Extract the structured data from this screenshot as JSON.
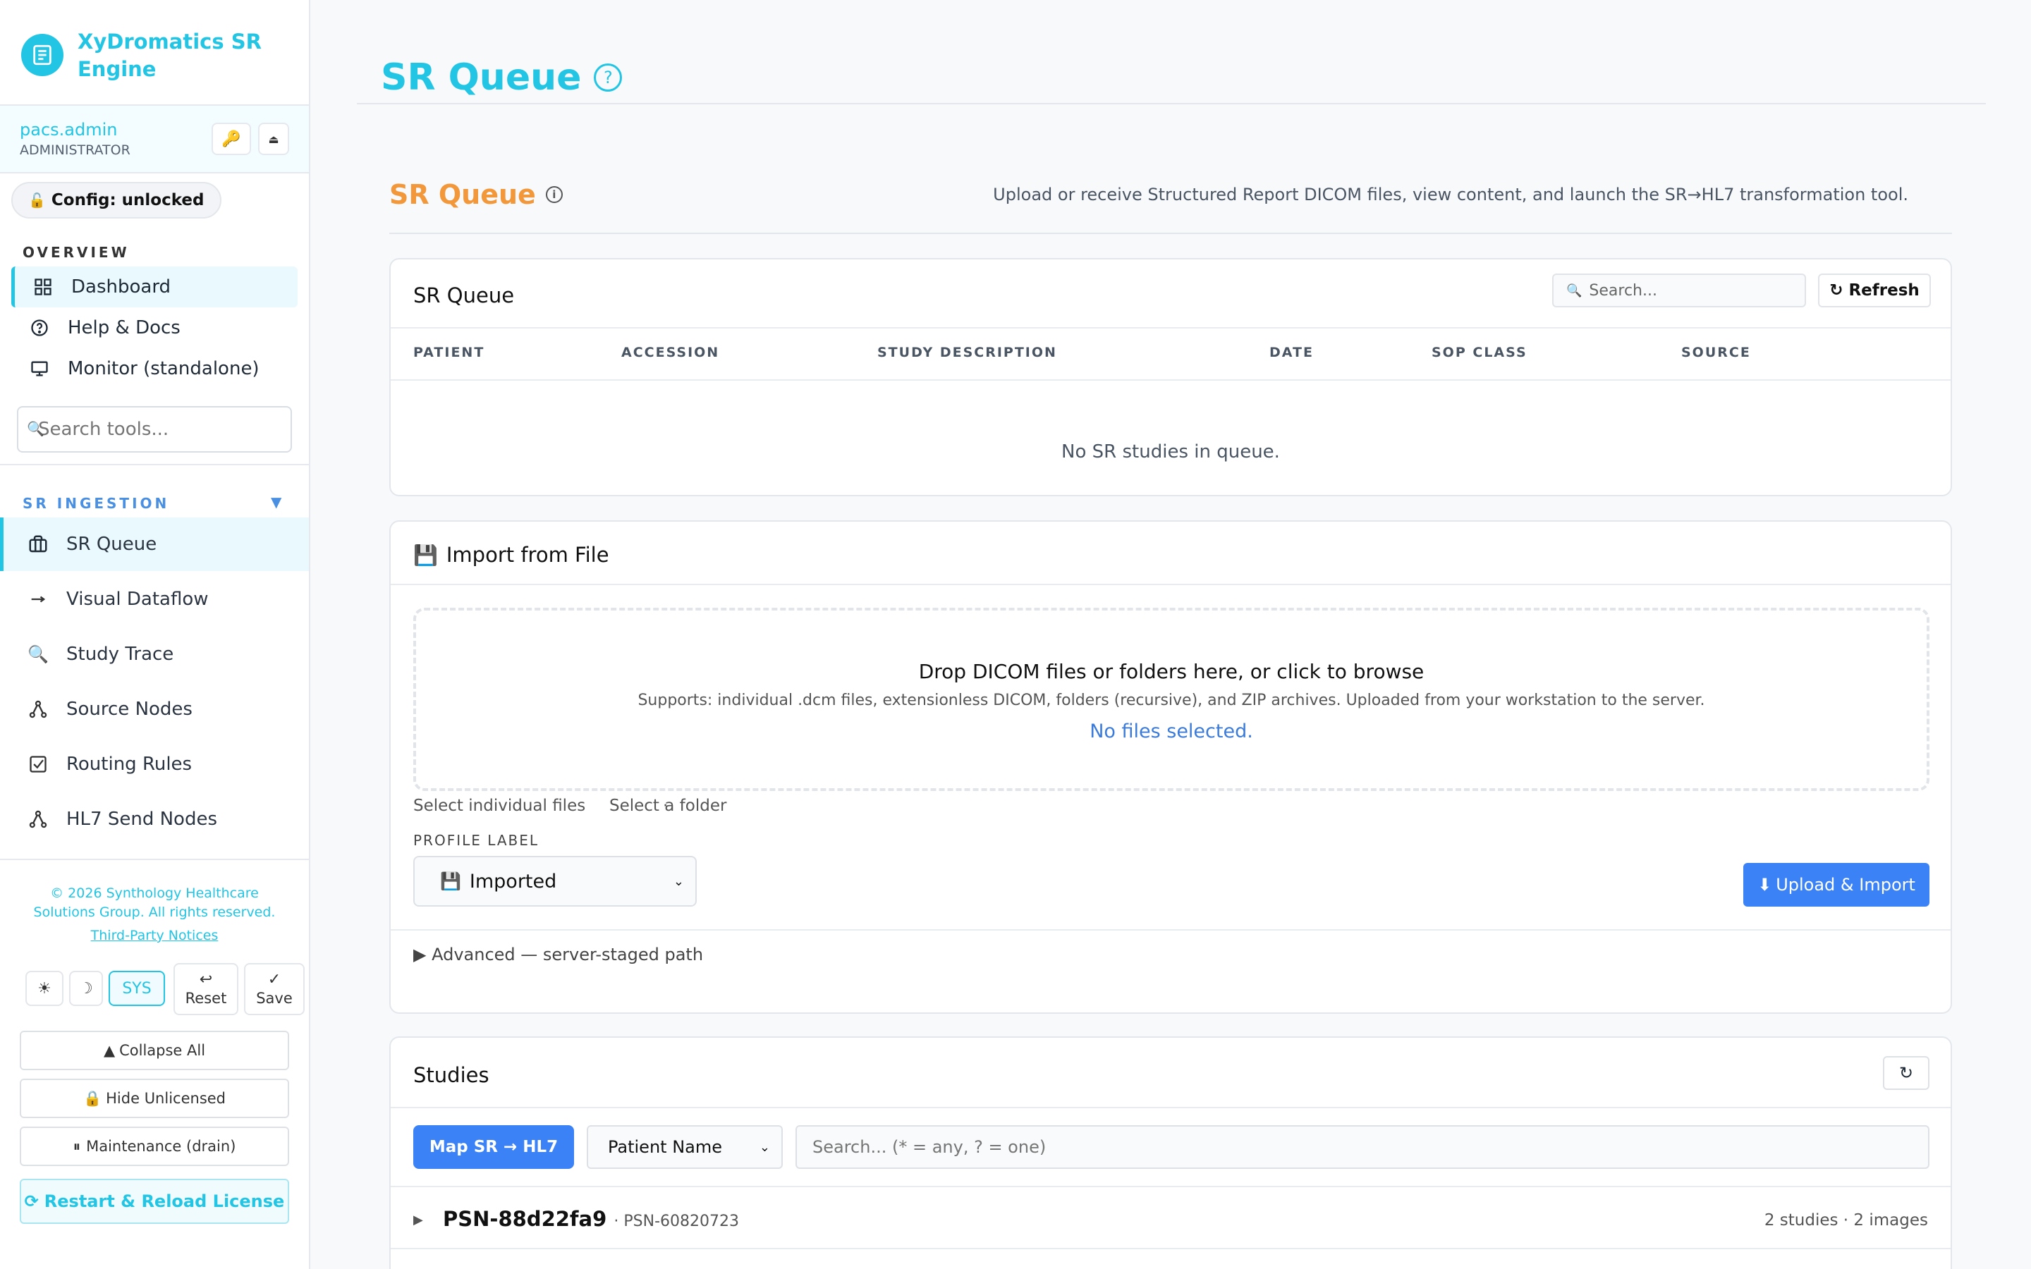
{
  "app": {
    "brand": "XyDromatics SR Engine",
    "user": "pacs.admin",
    "role": "ADMINISTRATOR",
    "config_badge": "Config: unlocked",
    "accent": "#22c5e4",
    "orange": "#f2983a",
    "blue": "#3b82f6"
  },
  "sidebar": {
    "overview_label": "OVERVIEW",
    "overview_items": [
      "Dashboard",
      "Help & Docs",
      "Monitor (standalone)"
    ],
    "search_placeholder": "Search tools...",
    "ingestion_label": "SR INGESTION",
    "ingestion_items": [
      "SR Queue",
      "Visual Dataflow",
      "Study Trace",
      "Source Nodes",
      "Routing Rules",
      "HL7 Send Nodes"
    ],
    "footer_line1": "© 2026 Synthology Healthcare",
    "footer_line2": "Solutions Group. All rights reserved.",
    "footer_link": "Third-Party Notices",
    "theme_sys": "SYS",
    "reset": "Reset",
    "save": "Save",
    "collapse_all": "Collapse All",
    "hide_unlicensed": "Hide Unlicensed",
    "maintenance": "Maintenance (drain)",
    "restart": "Restart & Reload License"
  },
  "page": {
    "title": "SR Queue",
    "section_title": "SR Queue",
    "description": "Upload or receive Structured Report DICOM files, view content, and launch the SR→HL7 transformation tool."
  },
  "queue": {
    "title": "SR Queue",
    "search_placeholder": "Search...",
    "refresh": "Refresh",
    "columns": [
      "PATIENT",
      "ACCESSION",
      "STUDY DESCRIPTION",
      "DATE",
      "SOP CLASS",
      "SOURCE"
    ],
    "empty": "No SR studies in queue."
  },
  "import": {
    "title": "Import from File",
    "drop_title": "Drop DICOM files or folders here, or click to browse",
    "drop_sub": "Supports: individual .dcm files, extensionless DICOM, folders (recursive), and ZIP archives. Uploaded from your workstation to the server.",
    "no_files": "No files selected.",
    "select_files": "Select individual files",
    "separator": "·",
    "select_folder": "Select a folder",
    "profile_label": "PROFILE LABEL",
    "profile_value": "Imported",
    "upload": "Upload & Import",
    "advanced": "Advanced — server-staged path"
  },
  "studies": {
    "title": "Studies",
    "map_button": "Map SR → HL7",
    "filter_field": "Patient Name",
    "search_placeholder": "Search... (* = any, ? = one)",
    "rows": [
      {
        "patient": "PSN-88d22fa9",
        "sub": "· PSN-60820723",
        "count": "2 studies · 2 images"
      }
    ]
  }
}
